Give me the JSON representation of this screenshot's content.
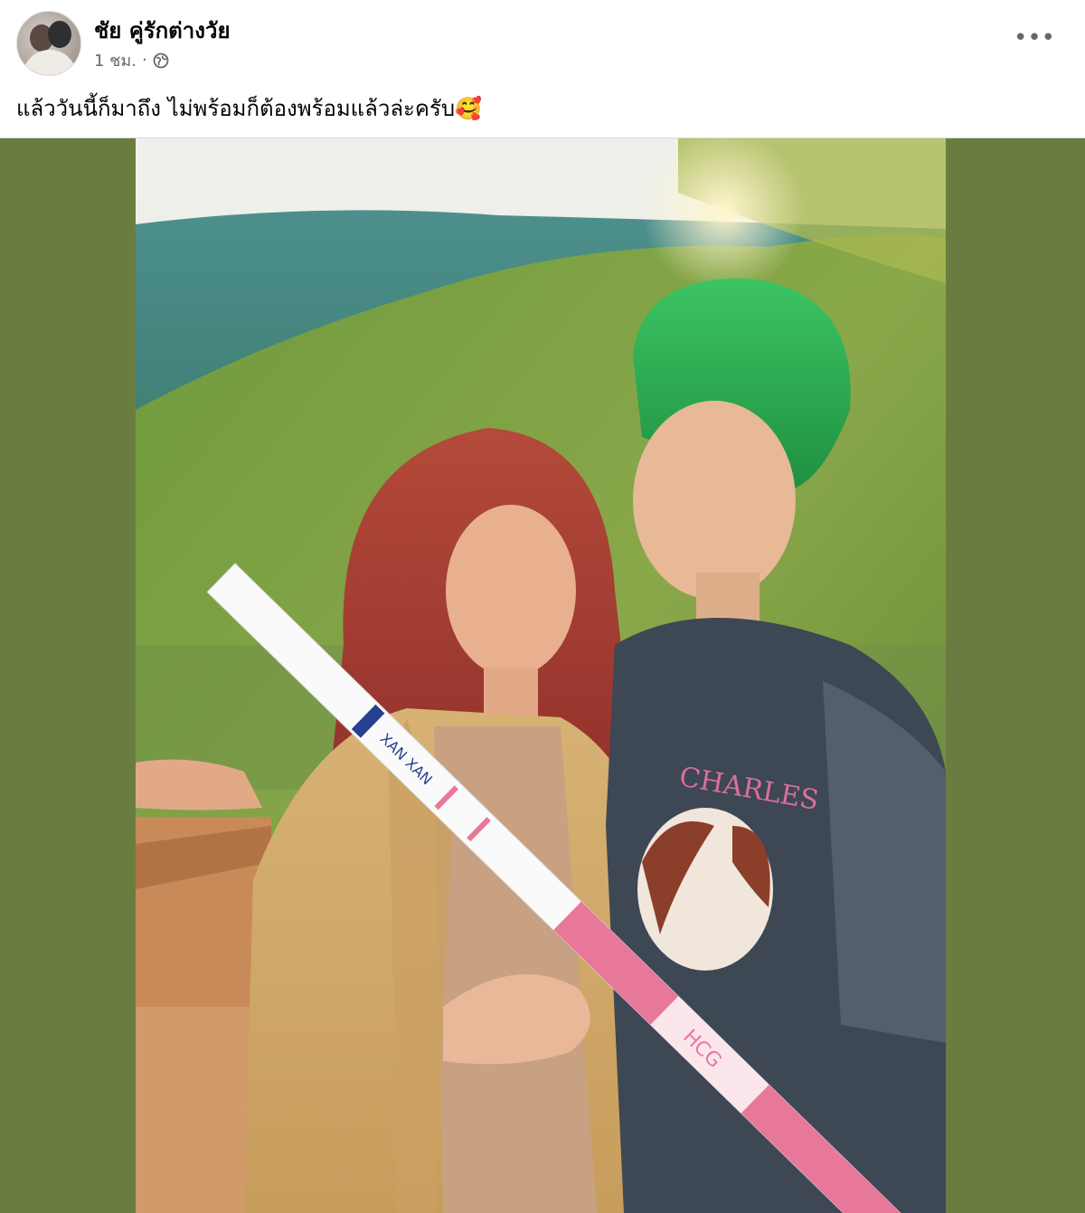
{
  "post": {
    "author_name": "ชัย คู่รักต่างวัย",
    "timestamp": "1 ชม.",
    "separator": "·",
    "audience_icon": "globe-icon",
    "more_icon": "more-options-icon",
    "caption": "แล้ววันนี้ก็มาถึง ไม่พร้อมก็ต้องพร้อมแล้วล่ะครับ🥰"
  },
  "photo": {
    "test_strip_brand": "XAN XAN",
    "test_strip_label": "HCG",
    "shirt_text": "CHARLES"
  },
  "colors": {
    "side_panel": "#6a7d41",
    "strip_pink": "#e8789a",
    "hair_green": "#2fae4e"
  }
}
